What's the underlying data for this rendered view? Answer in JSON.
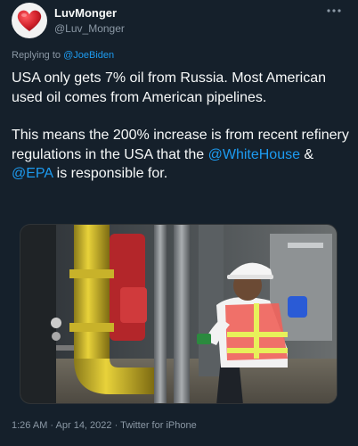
{
  "user": {
    "display_name": "LuvMonger",
    "handle": "@Luv_Monger",
    "avatar_icon": "heart-icon",
    "avatar_color": "#d0202a"
  },
  "reply_context": {
    "prefix": "Replying to ",
    "mention": "@JoeBiden"
  },
  "tweet": {
    "paragraph1": "USA only gets 7% oil from Russia. Most American used oil comes from American pipelines.",
    "p2_part1": "This means the 200% increase is from recent refinery regulations in the USA that the ",
    "p2_mention1": "@WhiteHouse",
    "p2_part2": " & ",
    "p2_mention2": "@EPA",
    "p2_part3": " is responsible for."
  },
  "media": {
    "type": "photo",
    "subject": "worker in hard hat and safety vest at refinery pipes"
  },
  "meta": {
    "timestamp": "1:26 AM · Apr 14, 2022 · Twitter for iPhone"
  },
  "colors": {
    "background": "#15202b",
    "link": "#1d9bf0",
    "secondary_text": "#8b98a5"
  }
}
